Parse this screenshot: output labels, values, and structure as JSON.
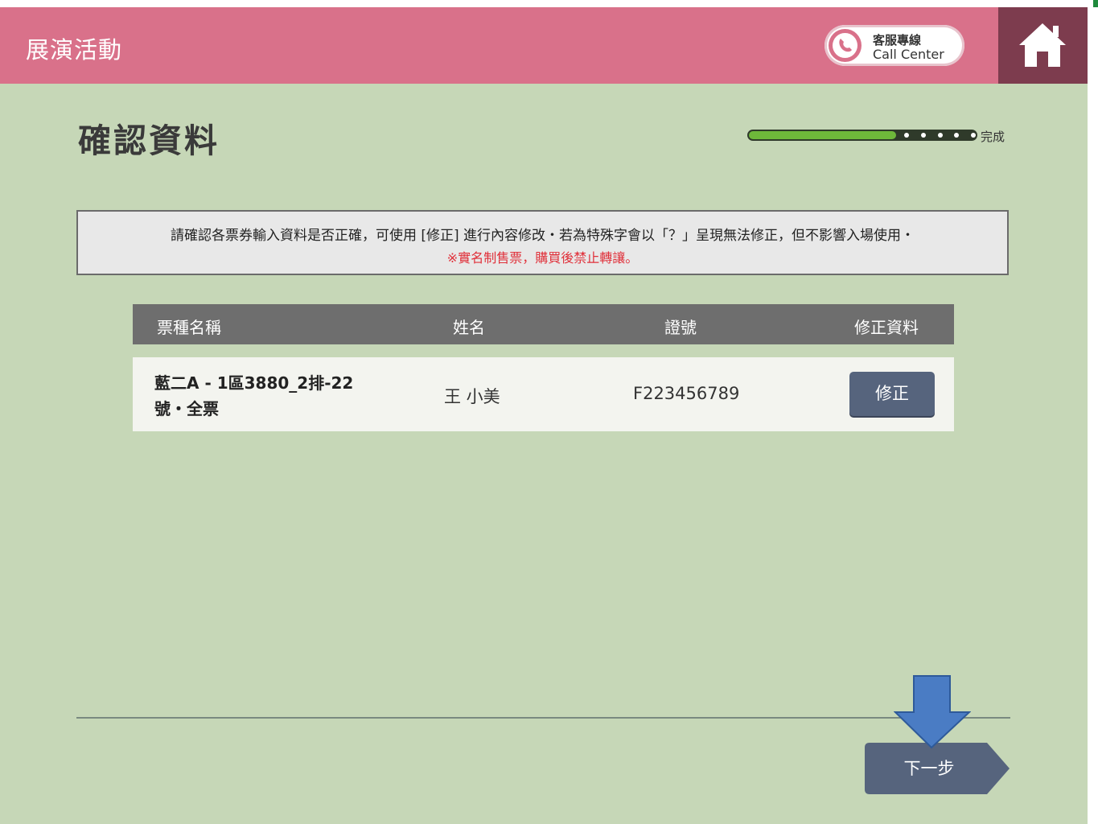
{
  "header": {
    "app_title": "展演活動",
    "callcenter_zh": "客服專線",
    "callcenter_en": "Call Center"
  },
  "page": {
    "title": "確認資料"
  },
  "progress": {
    "label": "完成",
    "fraction": 0.65,
    "remaining_dots": 5
  },
  "notice": {
    "line1": "請確認各票券輸入資料是否正確，可使用 [修正] 進行內容修改・若為特殊字會以「？」呈現無法修正，但不影響入場使用・",
    "line2": "※實名制售票，購買後禁止轉讓。"
  },
  "table": {
    "headers": [
      "票種名稱",
      "姓名",
      "證號",
      "修正資料"
    ],
    "rows": [
      {
        "ticket_type": "藍二A - 1區3880_2排-22號・全票",
        "name": "王 小美",
        "id_number": "F223456789",
        "edit_label": "修正"
      }
    ]
  },
  "footer": {
    "next_label": "下一步"
  },
  "colors": {
    "header": "#d9718a",
    "home": "#7d3c4e",
    "background": "#c6d7b7",
    "button": "#56647d",
    "arrow": "#4a7cc4",
    "notice_red": "#e0303a"
  }
}
